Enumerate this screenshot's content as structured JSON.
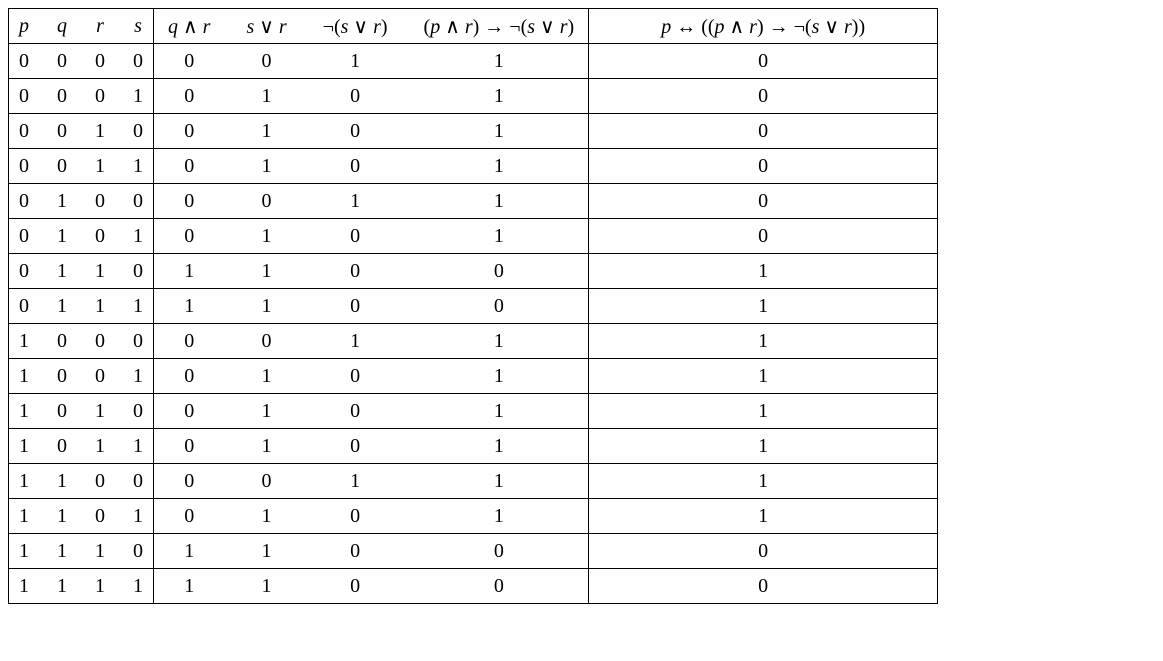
{
  "headers": {
    "h1": "p",
    "h2": "q",
    "h3": "r",
    "h4": "s",
    "h5": "q ∧ r",
    "h6": "s ∨ r",
    "h7": "¬(s ∨ r)",
    "h8": "(p ∧ r) → ¬(s ∨ r)",
    "h9": "p ↔ ((p ∧ r) → ¬(s ∨ r))"
  },
  "chart_data": {
    "type": "table",
    "columns": [
      "p",
      "q",
      "r",
      "s",
      "q ∧ r",
      "s ∨ r",
      "¬(s ∨ r)",
      "(p ∧ r) → ¬(s ∨ r)",
      "p ↔ ((p ∧ r) → ¬(s ∨ r))"
    ],
    "rows": [
      [
        0,
        0,
        0,
        0,
        0,
        0,
        1,
        1,
        0
      ],
      [
        0,
        0,
        0,
        1,
        0,
        1,
        0,
        1,
        0
      ],
      [
        0,
        0,
        1,
        0,
        0,
        1,
        0,
        1,
        0
      ],
      [
        0,
        0,
        1,
        1,
        0,
        1,
        0,
        1,
        0
      ],
      [
        0,
        1,
        0,
        0,
        0,
        0,
        1,
        1,
        0
      ],
      [
        0,
        1,
        0,
        1,
        0,
        1,
        0,
        1,
        0
      ],
      [
        0,
        1,
        1,
        0,
        1,
        1,
        0,
        0,
        1
      ],
      [
        0,
        1,
        1,
        1,
        1,
        1,
        0,
        0,
        1
      ],
      [
        1,
        0,
        0,
        0,
        0,
        0,
        1,
        1,
        1
      ],
      [
        1,
        0,
        0,
        1,
        0,
        1,
        0,
        1,
        1
      ],
      [
        1,
        0,
        1,
        0,
        0,
        1,
        0,
        1,
        1
      ],
      [
        1,
        0,
        1,
        1,
        0,
        1,
        0,
        1,
        1
      ],
      [
        1,
        1,
        0,
        0,
        0,
        0,
        1,
        1,
        1
      ],
      [
        1,
        1,
        0,
        1,
        0,
        1,
        0,
        1,
        1
      ],
      [
        1,
        1,
        1,
        0,
        1,
        1,
        0,
        0,
        0
      ],
      [
        1,
        1,
        1,
        1,
        1,
        1,
        0,
        0,
        0
      ]
    ]
  }
}
